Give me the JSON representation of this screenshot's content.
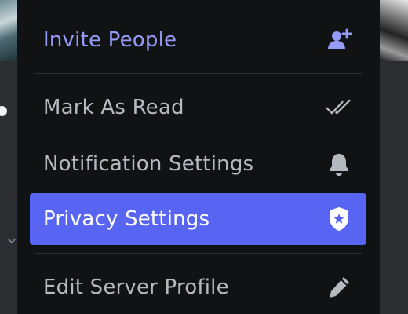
{
  "menu": {
    "items": [
      {
        "label": "Invite People",
        "icon": "add-user-icon"
      },
      {
        "label": "Mark As Read",
        "icon": "double-check-icon"
      },
      {
        "label": "Notification Settings",
        "icon": "bell-icon"
      },
      {
        "label": "Privacy Settings",
        "icon": "shield-star-icon"
      },
      {
        "label": "Edit Server Profile",
        "icon": "pencil-icon"
      }
    ],
    "active_index": 3
  },
  "colors": {
    "menu_background": "#111214",
    "active_background": "#5865f2",
    "accent_text": "#949cf7",
    "default_text": "#b5bac1",
    "page_background": "#2b2d31"
  }
}
